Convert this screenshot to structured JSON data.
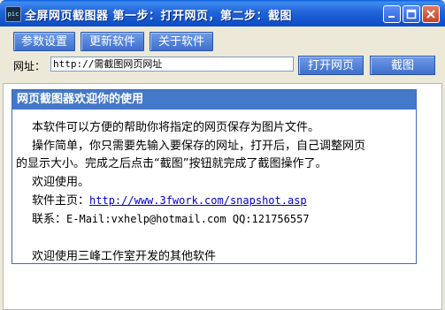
{
  "window": {
    "title": "全屏网页截图器 第一步：打开网页，第二步：截图",
    "icon_text": "pic"
  },
  "toolbar": {
    "settings_label": "参数设置",
    "update_label": "更新软件",
    "about_label": "关于软件"
  },
  "url": {
    "label": "网址：",
    "value": "http://需截图网页网址"
  },
  "actions": {
    "open_label": "打开网页",
    "capture_label": "截图"
  },
  "welcome": {
    "heading": "网页截图器欢迎你的使用",
    "line1": "本软件可以方便的帮助你将指定的网页保存为图片文件。",
    "line2a": "操作简单，你只需要先输入要保存的网址，打开后，自己调整网页",
    "line2b": "的显示大小。完成之后点击“截图”按钮就完成了截图操作了。",
    "line3": "欢迎使用。",
    "homepage_label": "软件主页：",
    "homepage_url": "http://www.3fwork.com/snapshot.asp",
    "contact_label": "联系：",
    "contact_text": "E-Mail:vxhelp@hotmail.com QQ:121756557",
    "other_software": "欢迎使用三峰工作室开发的其他软件"
  },
  "colors": {
    "titlebar": "#2264D9",
    "button": "#4F7FD6",
    "panel_header": "#4478C8",
    "link": "#0000CC"
  }
}
